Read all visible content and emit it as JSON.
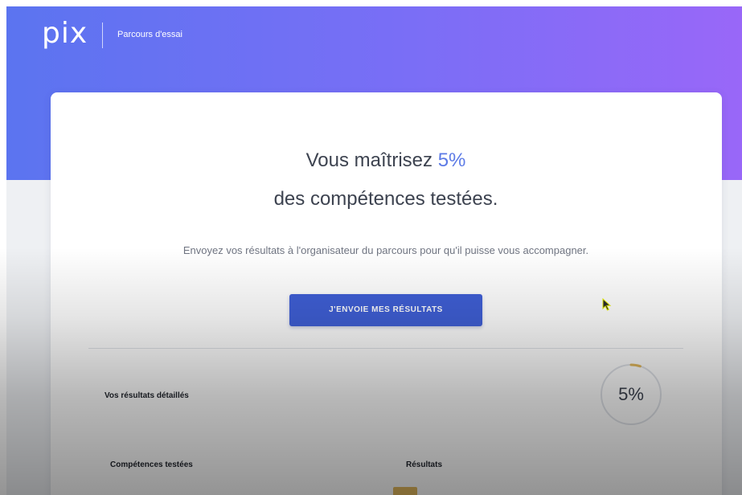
{
  "header": {
    "logo": "pix",
    "title": "Parcours d'essai"
  },
  "result": {
    "headline_prefix": "Vous maîtrisez ",
    "percent": "5%",
    "headline_line2": "des compétences testées.",
    "description": "Envoyez vos résultats à l'organisateur du parcours pour qu'il puisse vous accompagner.",
    "send_button_label": "J'ENVOIE MES RÉSULTATS"
  },
  "details": {
    "title": "Vos résultats détaillés",
    "score": "5%",
    "score_fraction": 0.05,
    "column_skills": "Compétences testées",
    "column_results": "Résultats"
  },
  "colors": {
    "gradient_start": "#5b74f0",
    "gradient_end": "#9967f8",
    "accent": "#5c7ae6",
    "button": "#3f5fd6",
    "progress_ring": "#e2b85c"
  },
  "icons": {
    "cursor": "mouse-pointer-icon"
  }
}
